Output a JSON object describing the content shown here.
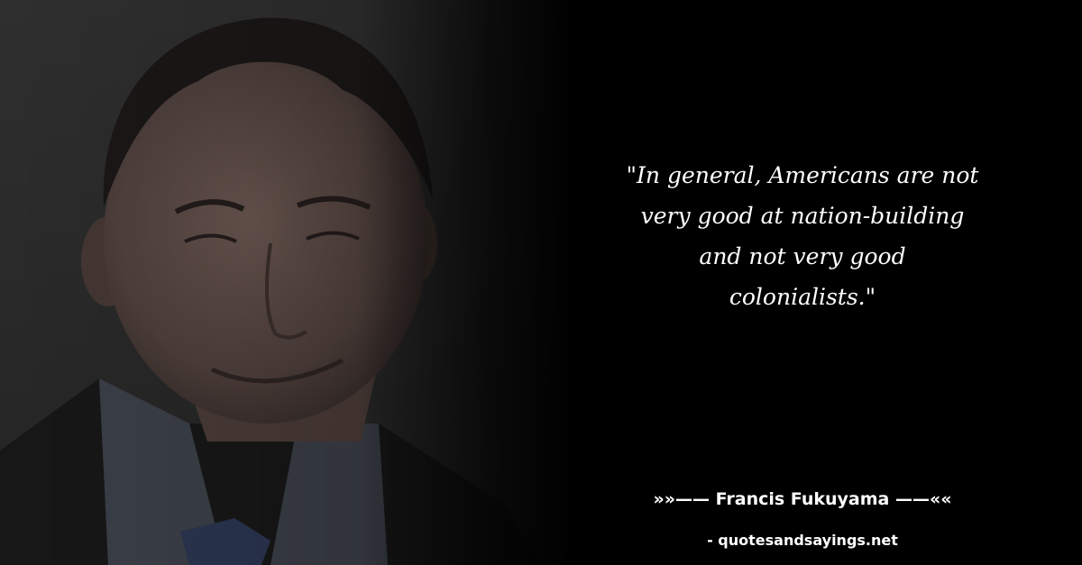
{
  "quote": {
    "lines": [
      "\"In general, Americans are not",
      "very good at nation-building",
      "and not very good",
      "colonialists.\""
    ]
  },
  "attribution": {
    "author_line": "»»—— Francis Fukuyama ——««",
    "site": "- quotesandsayings.net"
  },
  "colors": {
    "background": "#000000",
    "text": "#ffffff"
  }
}
